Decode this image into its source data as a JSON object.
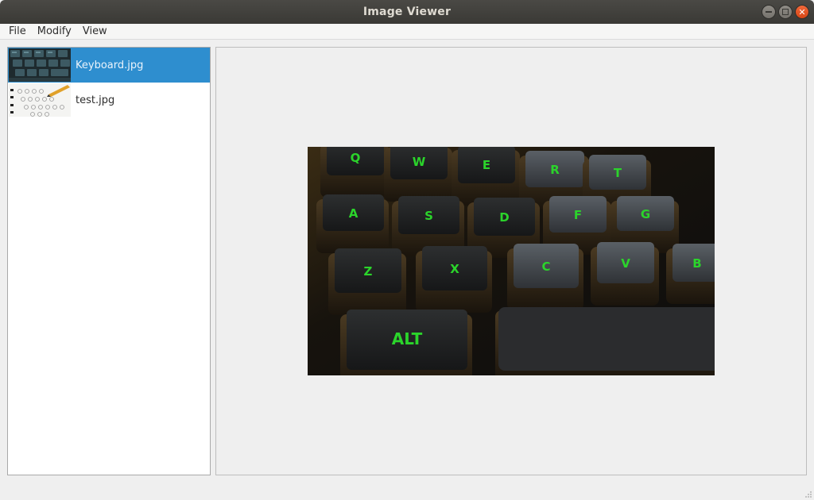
{
  "window": {
    "title": "Image Viewer"
  },
  "menu": {
    "items": [
      "File",
      "Modify",
      "View"
    ]
  },
  "files": [
    {
      "name": "Keyboard.jpg",
      "selected": true
    },
    {
      "name": "test.jpg",
      "selected": false
    }
  ],
  "viewer": {
    "image": "Keyboard.jpg"
  },
  "photo_keys": [
    "Q",
    "W",
    "E",
    "R",
    "T",
    "A",
    "S",
    "D",
    "F",
    "G",
    "Z",
    "X",
    "C",
    "V",
    "B",
    "ALT"
  ],
  "colors": {
    "selection": "#2e8ecf",
    "key_glow": "#2bd42b",
    "close_button": "#e5531f"
  }
}
